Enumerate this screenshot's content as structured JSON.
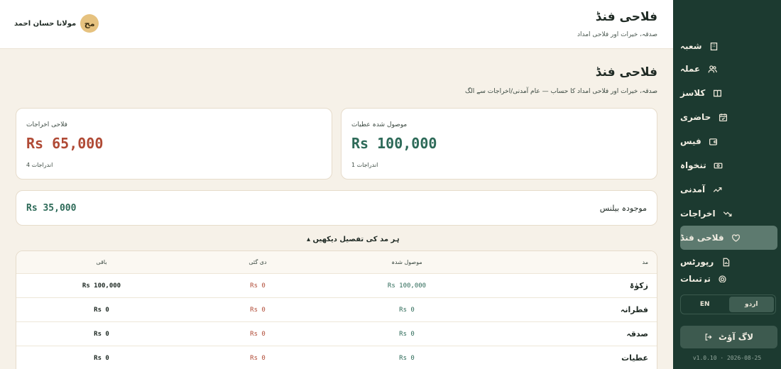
{
  "sidebar": {
    "items": [
      {
        "label": "شعبہ",
        "icon": "building-icon",
        "active": false
      },
      {
        "label": "عملہ",
        "icon": "users-icon",
        "active": false
      },
      {
        "label": "کلاسز",
        "icon": "book-icon",
        "active": false
      },
      {
        "label": "حاضری",
        "icon": "calendar-check-icon",
        "active": false
      },
      {
        "label": "فیس",
        "icon": "wallet-icon",
        "active": false
      },
      {
        "label": "تنخواہ",
        "icon": "banknote-icon",
        "active": false
      },
      {
        "label": "آمدنی",
        "icon": "trend-up-icon",
        "active": false
      },
      {
        "label": "اخراجات",
        "icon": "trend-down-icon",
        "active": false
      },
      {
        "label": "فلاحی فنڈ",
        "icon": "heart-hand-icon",
        "active": true
      },
      {
        "label": "رپورٹس",
        "icon": "file-report-icon",
        "active": false
      },
      {
        "label": "ترتیبات",
        "icon": "gear-icon",
        "active": false
      }
    ],
    "lang_urdu": "اردو",
    "lang_en": "EN",
    "logout": "لاگ آؤٹ",
    "version": "v1.0.10 · 2026-08-25"
  },
  "header": {
    "title": "فلاحی فنڈ",
    "subtitle": "صدقہ، خیرات اور فلاحی امداد",
    "user_name": "مولانا حسان احمد",
    "avatar_initials": "مح"
  },
  "page": {
    "title": "فلاحی فنڈ",
    "subtitle": "صدقہ، خیرات اور فلاحی امداد کا حساب — عام آمدنی/اخراجات سے الگ"
  },
  "cards": {
    "received": {
      "label": "موصول شدہ عطیات",
      "value": "Rs 100,000",
      "count": "1 اندراجات"
    },
    "expenses": {
      "label": "فلاحی اخراجات",
      "value": "Rs 65,000",
      "count": "4 اندراجات"
    },
    "balance": {
      "label": "موجودہ بیلنس",
      "value": "Rs 35,000"
    }
  },
  "toggle_label": "ہر مد کی تفصیل دیکھیں ▴",
  "table": {
    "headers": {
      "fund": "مد",
      "received": "موصول شدہ",
      "given": "دی گئی",
      "remaining": "باقی"
    },
    "rows": [
      {
        "fund": "زکوٰۃ",
        "received": "Rs 100,000",
        "given": "Rs 0",
        "remaining": "Rs 100,000"
      },
      {
        "fund": "فطرانہ",
        "received": "Rs 0",
        "given": "Rs 0",
        "remaining": "Rs 0"
      },
      {
        "fund": "صدقہ",
        "received": "Rs 0",
        "given": "Rs 0",
        "remaining": "Rs 0"
      },
      {
        "fund": "عطیات",
        "received": "Rs 0",
        "given": "Rs 0",
        "remaining": "Rs 0"
      }
    ]
  },
  "colors": {
    "sidebar_bg": "#1c3a30",
    "active_item": "#5d7a6f",
    "accent_green": "#2d6a58",
    "accent_red": "#b04a35",
    "page_bg": "#f6f1e8",
    "avatar_bg": "#e6c27f"
  }
}
